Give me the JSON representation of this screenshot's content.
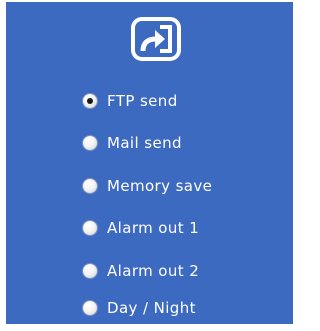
{
  "icons": {
    "header": "export-arrow-icon"
  },
  "colors": {
    "panel_bg": "#3d6ac1",
    "label": "#ffffff"
  },
  "options": [
    {
      "label": "FTP send",
      "selected": true
    },
    {
      "label": "Mail send",
      "selected": false
    },
    {
      "label": "Memory save",
      "selected": false
    },
    {
      "label": "Alarm out 1",
      "selected": false
    },
    {
      "label": "Alarm out 2",
      "selected": false
    },
    {
      "label": "Day / Night",
      "selected": false
    }
  ]
}
